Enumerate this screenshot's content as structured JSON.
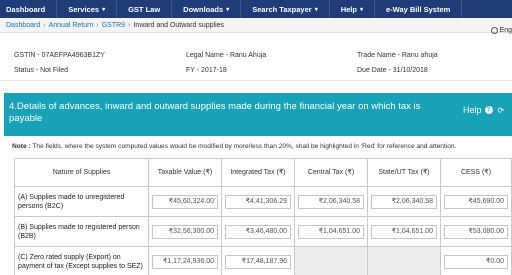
{
  "nav": {
    "items": [
      {
        "label": "Dashboard",
        "dropdown": false
      },
      {
        "label": "Services",
        "dropdown": true
      },
      {
        "label": "GST Law",
        "dropdown": false
      },
      {
        "label": "Downloads",
        "dropdown": true
      },
      {
        "label": "Search Taxpayer",
        "dropdown": true
      },
      {
        "label": "Help",
        "dropdown": true
      },
      {
        "label": "e-Way Bill System",
        "dropdown": false
      }
    ]
  },
  "breadcrumb": {
    "items": [
      "Dashboard",
      "Annual Return",
      "GSTR9"
    ],
    "current": "Inward and Outward supplies",
    "language": "Eng"
  },
  "taxpayer": {
    "gstin": "GSTIN - 07AEFPA4963B1ZY",
    "legal_name": "Legal Name - Ranu Ahuja",
    "trade_name": "Trade Name - Ranu ahuja",
    "status": "Status - Not Filed",
    "fy": "FY - 2017-18",
    "due_date": "Due Date - 31/10/2018"
  },
  "section": {
    "title": "4.Details of advances, inward and outward supplies made during the financial year on which tax is payable",
    "help_label": "Help"
  },
  "note": {
    "prefix": "Note :",
    "text": "The fields, where the system computed values would be modified by more/less than 20%, shall be highlighted in 'Red' for reference and attention."
  },
  "table": {
    "headers": [
      "Nature of Supplies",
      "Taxable Value (₹)",
      "Integrated Tax (₹)",
      "Central Tax (₹)",
      "State/UT Tax (₹)",
      "CESS (₹)"
    ],
    "rows": [
      {
        "label": "(A) Supplies made to unregistered persons (B2C)",
        "taxable": "₹45,60,324.00",
        "igst": "₹4,41,306.29",
        "cgst": "₹2,06,340.58",
        "sgst": "₹2,06,340.58",
        "cess": "₹45,690.00"
      },
      {
        "label": "(B) Supplies made to registered person (B2B)",
        "taxable": "₹32,56,300.00",
        "igst": "₹3,46,480.00",
        "cgst": "₹1,04,651.00",
        "sgst": "₹1,04,651.00",
        "cess": "₹53,080.00"
      },
      {
        "label": "(C) Zero rated supply (Export) on payment of tax (Except supplies to SEZ)",
        "taxable": "₹1,17,24,936.00",
        "igst": "₹17,48,187.96",
        "cgst": "",
        "sgst": "",
        "cess": "₹0.00"
      }
    ]
  }
}
